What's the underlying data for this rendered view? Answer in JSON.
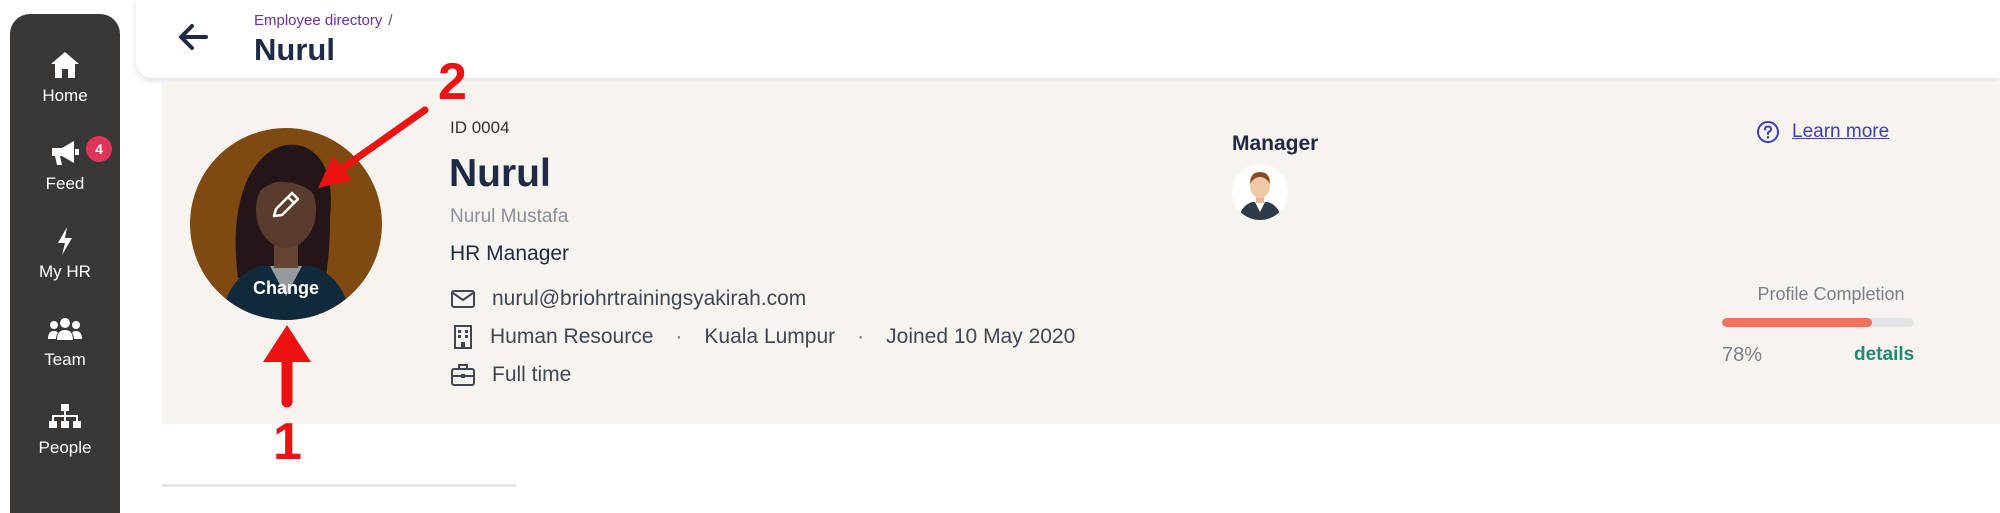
{
  "sidebar": {
    "items": [
      {
        "label": "Home",
        "icon": "home-icon"
      },
      {
        "label": "Feed",
        "icon": "megaphone-icon",
        "badge": "4"
      },
      {
        "label": "My HR",
        "icon": "lightning-icon"
      },
      {
        "label": "Team",
        "icon": "team-icon"
      },
      {
        "label": "People",
        "icon": "org-chart-icon"
      }
    ]
  },
  "header": {
    "breadcrumb": "Employee directory",
    "breadcrumb_sep": "/",
    "title": "Nurul"
  },
  "profile": {
    "avatar_action": "Change",
    "id": "ID 0004",
    "name": "Nurul",
    "full_name": "Nurul Mustafa",
    "job_title": "HR Manager",
    "email": "nurul@briohrtrainingsyakirah.com",
    "department": "Human Resource",
    "location": "Kuala Lumpur",
    "joined": "Joined 10 May 2020",
    "employment_type": "Full time",
    "dot": "·"
  },
  "manager": {
    "label": "Manager"
  },
  "help": {
    "learn_more": "Learn more"
  },
  "completion": {
    "label": "Profile Completion",
    "percent_text": "78%",
    "fraction": 0.78,
    "details": "details"
  },
  "annotations": {
    "step1": "1",
    "step2": "2"
  },
  "colors": {
    "sidebar_bg": "#3a3836",
    "badge": "#e0355a",
    "breadcrumb": "#6b2fa3",
    "progress_fill": "#f07258",
    "details_link": "#1d8a74",
    "annotation": "#ee1111"
  }
}
